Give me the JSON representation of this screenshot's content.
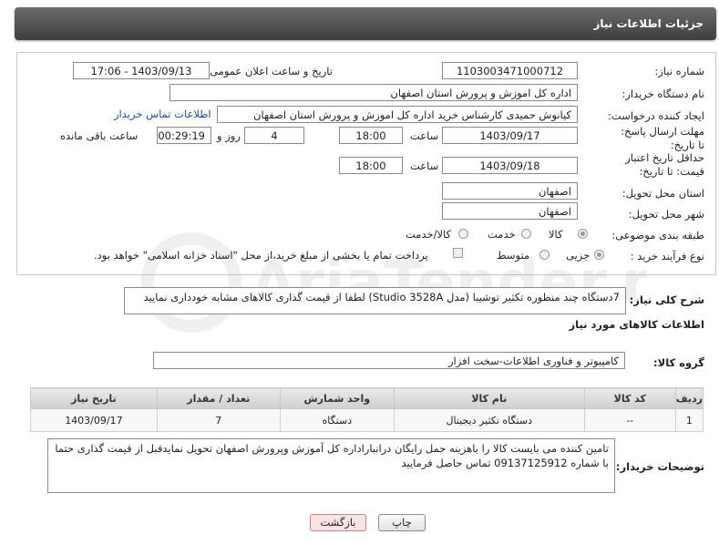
{
  "header": {
    "title": "جزئیات اطلاعات نیاز"
  },
  "fields": {
    "need_number_label": "شماره نیاز:",
    "need_number": "1103003471000712",
    "announce_label": "تاریخ و ساعت اعلان عمومی:",
    "announce_value": "1403/09/13 - 17:06",
    "buyer_org_label": "نام دستگاه خریدار:",
    "buyer_org": "اداره کل اموزش و پرورش استان اصفهان",
    "creator_label": "ایجاد کننده درخواست:",
    "creator": "کیانوش حمیدی کارشناس خرید اداره کل اموزش و پرورش استان اصفهان",
    "contact_link": "اطلاعات تماس خریدار",
    "reply_deadline_label": "مهلت ارسال پاسخ: تا تاریخ:",
    "reply_date": "1403/09/17",
    "time_label": "ساعت",
    "reply_time": "18:00",
    "days_count": "4",
    "days_label": "روز و",
    "remaining_time": "00:29:19",
    "remaining_label": "ساعت باقی مانده",
    "price_validity_label": "حداقل تاریخ اعتبار قیمت: تا تاریخ:",
    "validity_date": "1403/09/18",
    "validity_time": "18:00",
    "province_label": "استان محل تحویل:",
    "province": "اصفهان",
    "city_label": "شهر محل تحویل:",
    "city": "اصفهان",
    "category_label": "طبقه بندی موضوعی:",
    "category_options": [
      "کالا",
      "خدمت",
      "کالا/خدمت"
    ],
    "purchase_type_label": "نوع فرآیند خرید :",
    "purchase_options": [
      "جزیی",
      "متوسط"
    ],
    "treasury_note": "پرداخت تمام یا بخشی از مبلغ خرید،از محل \"اسناد خزانه اسلامی\" خواهد بود."
  },
  "description": {
    "label": "شرح کلی نیاز:",
    "text": "7دستگاه چند منظوره تکثیر توشیبا (مدل Studio 3528A) لطفا از قیمت گذاری کالاهای مشابه خودداری نمایید"
  },
  "goods_section": {
    "title": "اطلاعات کالاهای مورد نیاز",
    "group_label": "گروه کالا:",
    "group_value": "کامپیوتر و فناوری اطلاعات-سخت افزار"
  },
  "table": {
    "headers": [
      "ردیف",
      "کد کالا",
      "نام کالا",
      "واحد شمارش",
      "تعداد / مقدار",
      "تاریخ نیاز"
    ],
    "rows": [
      [
        "1",
        "--",
        "دستگاه تکثیر دیجیتال",
        "دستگاه",
        "7",
        "1403/09/17"
      ]
    ]
  },
  "buyer_notes": {
    "label": "توضیحات خریدار:",
    "text": "تامین کننده می بایست کالا را باهزینه حمل رایگان درانباراداره کل آموزش وپرورش  اصفهان تحویل نمایدقبل از قیمت گذاری حتما با شماره 09137125912 تماس حاصل فرمایید"
  },
  "buttons": {
    "print": "چاپ",
    "back": "بازگشت"
  },
  "watermark": "AriaTender.neT",
  "colors": {
    "header_dark": "#3e3e3e",
    "link": "#1a4ea8",
    "back_button_bg": "#fbe3e3"
  }
}
